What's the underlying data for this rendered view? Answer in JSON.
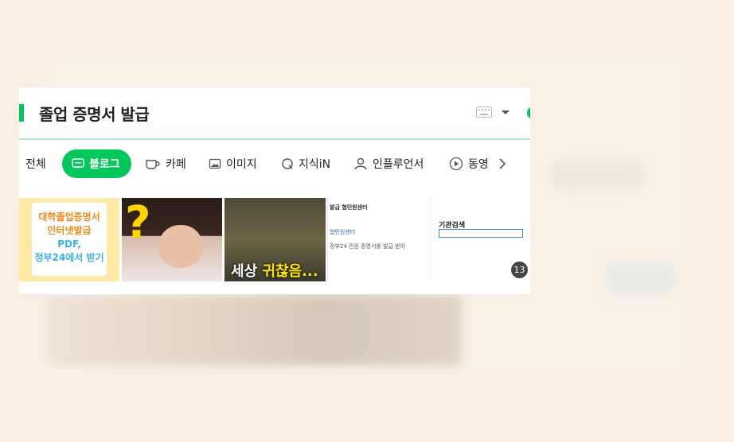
{
  "search": {
    "query": "졸업 증명서 발급"
  },
  "tabs": [
    {
      "label": "전체"
    },
    {
      "label": "블로그"
    },
    {
      "label": "카페"
    },
    {
      "label": "이미지"
    },
    {
      "label": "지식iN"
    },
    {
      "label": "인플루언서"
    },
    {
      "label": "동영"
    }
  ],
  "thumbnails": {
    "first": {
      "line1": "대학졸업증명서",
      "line2": "인터넷발급",
      "line3": "PDF,",
      "line4": "정부24에서 받기"
    },
    "third": {
      "caption_a": "세상",
      "caption_b": "귀찮음..."
    },
    "fourth": {
      "row1": "발급 협민원센터",
      "row2": "협민원센터",
      "row3": "정부24 민원 증명서를 발급 받아"
    },
    "fifth": {
      "heading": "기관검색"
    },
    "count": "13"
  },
  "colors": {
    "accent": "#03c75a",
    "background": "#f8eee3"
  },
  "icons": [
    "keyboard-icon",
    "chevron-down-icon",
    "blog-icon",
    "cafe-icon",
    "image-icon",
    "kin-icon",
    "person-icon",
    "play-icon",
    "chevron-right-icon"
  ]
}
